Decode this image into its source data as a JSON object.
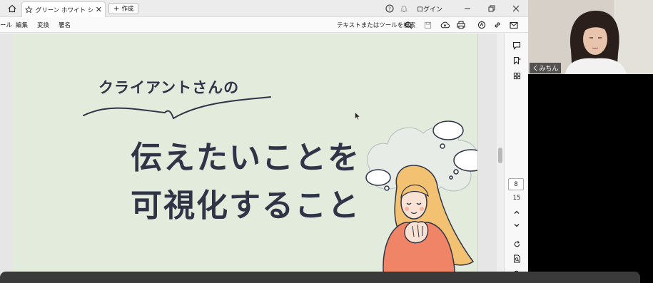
{
  "titlebar": {
    "tab_title": "グリーン ホワイト シンプル...",
    "tab_close": "✕",
    "new_label": "作成",
    "login_label": "ログイン"
  },
  "menubar": {
    "items": [
      "ール",
      "編集",
      "変換",
      "署名"
    ],
    "search_label": "テキストまたはツールを検索"
  },
  "slide": {
    "subtitle": "クライアントさんの",
    "headline_line1": "伝えたいことを",
    "headline_line2": "可視化すること"
  },
  "pagination": {
    "current_page": "8",
    "total_pages": "15"
  },
  "video": {
    "participant_name": "くみちん"
  },
  "colors": {
    "slide_bg": "#e3ebdc",
    "headline": "#2f3447",
    "hair": "#f2c272",
    "shirt": "#ef8566"
  }
}
